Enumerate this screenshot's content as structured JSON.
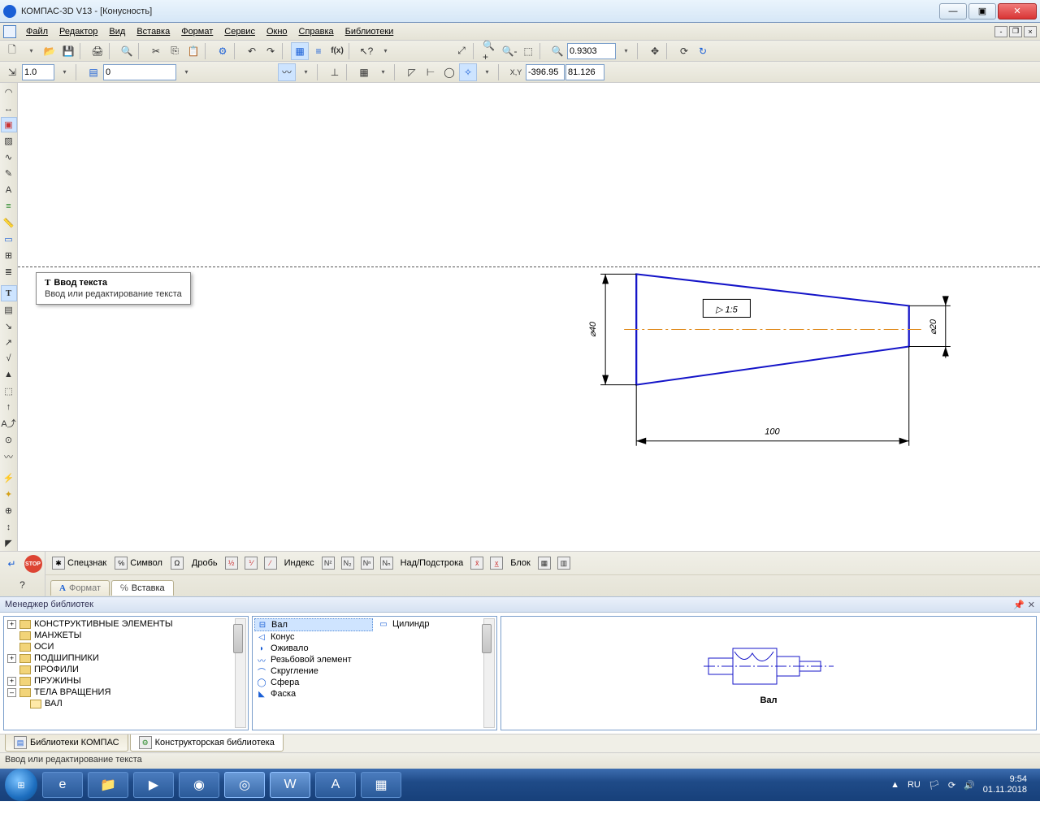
{
  "window": {
    "title": "КОМПАС-3D V13 - [Конусность]"
  },
  "menu": [
    "Файл",
    "Редактор",
    "Вид",
    "Вставка",
    "Формат",
    "Сервис",
    "Окно",
    "Справка",
    "Библиотеки"
  ],
  "toolbar1": {
    "zoom_value": "0.9303",
    "fx_label": "f(x)"
  },
  "toolbar2": {
    "scale": "1.0",
    "layer": "0",
    "coord_x": "-396.95",
    "coord_y": "81.126"
  },
  "tooltip": {
    "title": "Ввод текста",
    "desc": "Ввод или редактирование текста"
  },
  "drawing": {
    "dim_left": "⌀40",
    "dim_right": "⌀20",
    "dim_bottom": "100",
    "taper_label": "▷ 1:5"
  },
  "textbar": {
    "stop": "STOP",
    "spec": "Спецзнак",
    "symbol": "Символ",
    "frac": "Дробь",
    "index": "Индекс",
    "supersub": "Над/Подстрока",
    "block": "Блок",
    "tabs": {
      "format": "Формат",
      "insert": "Вставка"
    }
  },
  "libmgr": {
    "title": "Менеджер библиотек",
    "tree": [
      "КОНСТРУКТИВНЫЕ ЭЛЕМЕНТЫ",
      "МАНЖЕТЫ",
      "ОСИ",
      "ПОДШИПНИКИ",
      "ПРОФИЛИ",
      "ПРУЖИНЫ",
      "ТЕЛА ВРАЩЕНИЯ"
    ],
    "tree_child": "ВАЛ",
    "list_col1": [
      "Вал",
      "Конус",
      "Оживало",
      "Резьбовой элемент",
      "Скругление",
      "Сфера",
      "Фаска"
    ],
    "list_col2": [
      "Цилиндр"
    ],
    "preview_label": "Вал",
    "tabs": [
      "Библиотеки КОМПАС",
      "Конструкторская библиотека"
    ]
  },
  "statusbar": "Ввод или редактирование текста",
  "taskbar": {
    "lang": "RU",
    "time": "9:54",
    "date": "01.11.2018"
  }
}
